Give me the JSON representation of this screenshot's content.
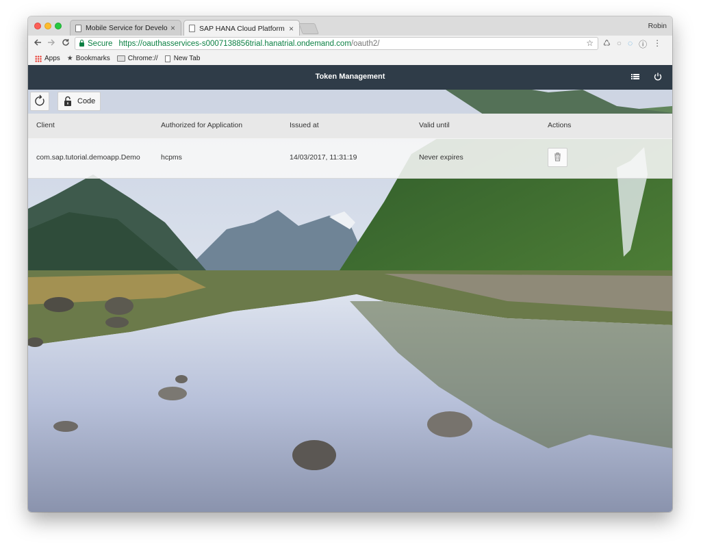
{
  "browser": {
    "tabs": [
      {
        "title": "Mobile Service for Developmer",
        "close": "×"
      },
      {
        "title": "SAP HANA Cloud Platform",
        "close": "×"
      }
    ],
    "profile_name": "Robin",
    "secure_label": "Secure",
    "url_host": "https://oauthasservices-s0007138856trial.hanatrial.ondemand.com",
    "url_path": "/oauth2/",
    "bookmarks": [
      {
        "label": "Apps",
        "icon": "apps-grid-icon"
      },
      {
        "label": "Bookmarks",
        "icon": "star-icon"
      },
      {
        "label": "Chrome://",
        "icon": "folder-icon"
      },
      {
        "label": "New Tab",
        "icon": "document-icon"
      }
    ]
  },
  "app": {
    "title": "Token Management",
    "header_icons": [
      "list-icon",
      "power-icon"
    ],
    "toolbar": {
      "refresh_icon": "refresh-icon",
      "code_label": "Code",
      "code_icon": "lock-icon"
    },
    "table": {
      "columns": [
        "Client",
        "Authorized for Application",
        "Issued at",
        "Valid until",
        "Actions"
      ],
      "rows": [
        {
          "client": "com.sap.tutorial.demoapp.Demo",
          "application": "hcpms",
          "issued_at": "14/03/2017, 11:31:19",
          "valid_until": "Never expires",
          "action_icon": "trash-icon"
        }
      ]
    },
    "colors": {
      "shell_bar": "#2f3c48",
      "secure_green": "#0b8043"
    }
  }
}
